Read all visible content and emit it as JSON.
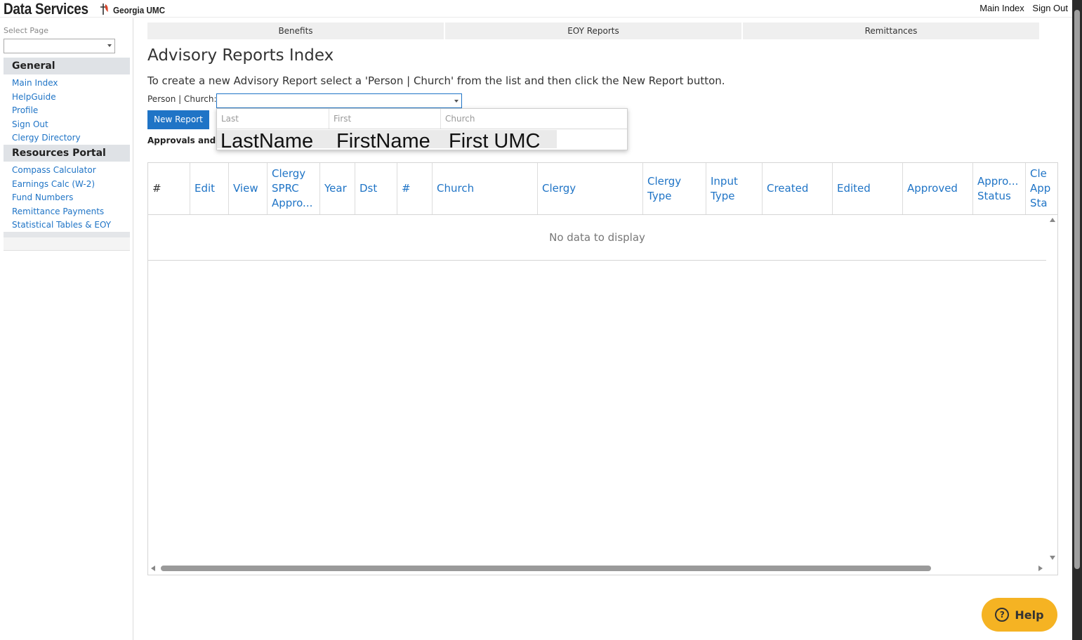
{
  "brand": {
    "title": "Data Services",
    "subtitle": "Georgia UMC",
    "logo_icon": "cross-flame-icon"
  },
  "top_links": {
    "main_index": "Main Index",
    "sign_out": "Sign Out"
  },
  "sidebar": {
    "select_label": "Select Page",
    "select_value": "",
    "groups": [
      {
        "title": "General",
        "items": [
          "Main Index",
          "HelpGuide",
          "Profile",
          "Sign Out",
          "Clergy Directory"
        ]
      },
      {
        "title": "Resources Portal",
        "items": [
          "Compass Calculator",
          "Earnings Calc (W-2)",
          "Fund Numbers",
          "Remittance Payments",
          "Statistical Tables & EOY"
        ]
      }
    ]
  },
  "tabs": [
    "Benefits",
    "EOY Reports",
    "Remittances"
  ],
  "main": {
    "title": "Advisory Reports Index",
    "instructions": "To create a new Advisory Report select a 'Person | Church' from the list and then click the New Report button.",
    "person_church_label": "Person | Church:",
    "person_church_value": "",
    "new_report_label": "New Report",
    "approvals_label": "Approvals and E"
  },
  "dropdown": {
    "columns": [
      "Last",
      "First",
      "Church"
    ],
    "rows": [
      {
        "last": "LastName",
        "first": "FirstName",
        "church": "First UMC"
      }
    ]
  },
  "grid": {
    "columns": [
      "#",
      "Edit",
      "View",
      "Clergy SPRC Appro...",
      "Year",
      "Dst",
      "#",
      "Church",
      "Clergy",
      "Clergy Type",
      "Input Type",
      "Created",
      "Edited",
      "Approved",
      "Appro... Status",
      "Cle App Sta"
    ],
    "empty_text": "No data to display"
  },
  "help_button": {
    "label": "Help",
    "icon": "question-circle-icon",
    "color": "#f5b323"
  },
  "colors": {
    "link": "#1f74c6",
    "button": "#1f74c6"
  }
}
